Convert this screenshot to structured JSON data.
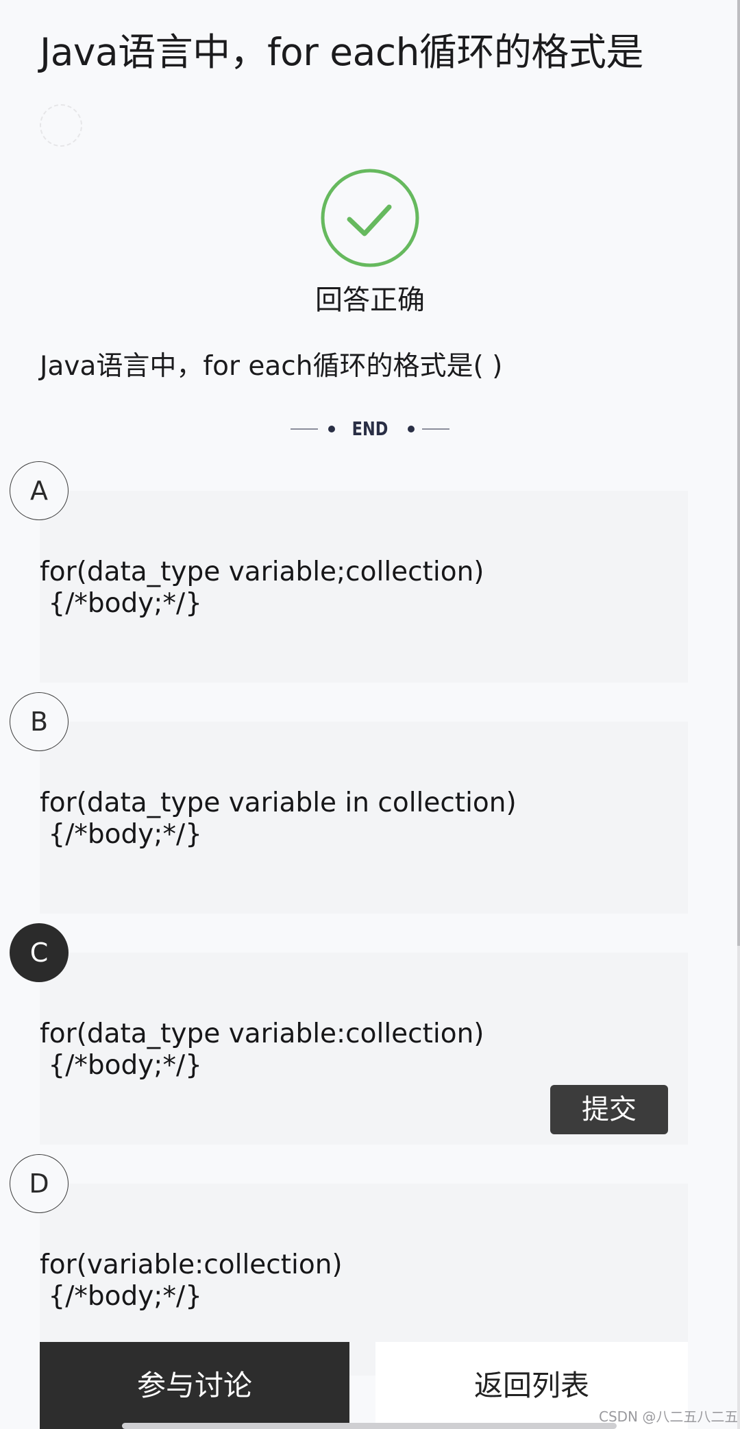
{
  "page": {
    "title": "Java语言中，for each循环的格式是",
    "result_text": "回答正确",
    "question": "Java语言中，for each循环的格式是( )",
    "end_label": "END"
  },
  "options": [
    {
      "letter": "A",
      "text": "for(data_type variable;collection)\n {/*body;*/}",
      "selected": false
    },
    {
      "letter": "B",
      "text": "for(data_type variable in collection)\n {/*body;*/}",
      "selected": false
    },
    {
      "letter": "C",
      "text": "for(data_type variable:collection)\n {/*body;*/}",
      "selected": true
    },
    {
      "letter": "D",
      "text": "for(variable:collection)\n {/*body;*/}",
      "selected": false
    }
  ],
  "buttons": {
    "submit": "提交",
    "discuss": "参与讨论",
    "back_to_list": "返回列表"
  },
  "watermark": "CSDN @八二五八二五",
  "colors": {
    "success": "#66b95e",
    "selected": "#2b2b2b",
    "background": "#f8f9fb",
    "card": "#f3f4f6"
  },
  "icons": {
    "result": "check-circle-icon"
  }
}
